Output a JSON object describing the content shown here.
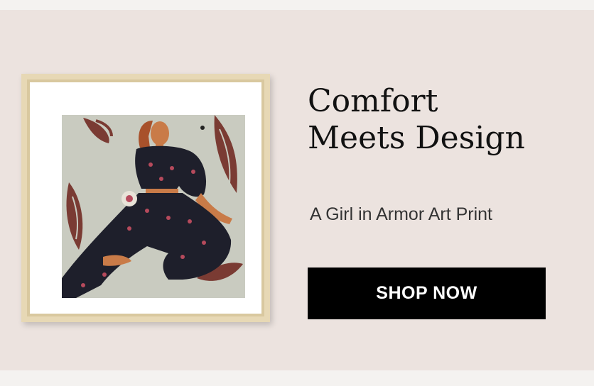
{
  "banner": {
    "headline_line1": "Comfort",
    "headline_line2": "Meets Design",
    "subtitle": "A Girl in Armor Art Print",
    "cta_label": "SHOP NOW"
  },
  "artwork": {
    "icon": "framed-art-print-woman-illustration"
  },
  "colors": {
    "page_background": "#f4f2f0",
    "banner_background": "#ece3df",
    "frame": "#e7d8b5",
    "button": "#000000",
    "button_text": "#ffffff"
  }
}
